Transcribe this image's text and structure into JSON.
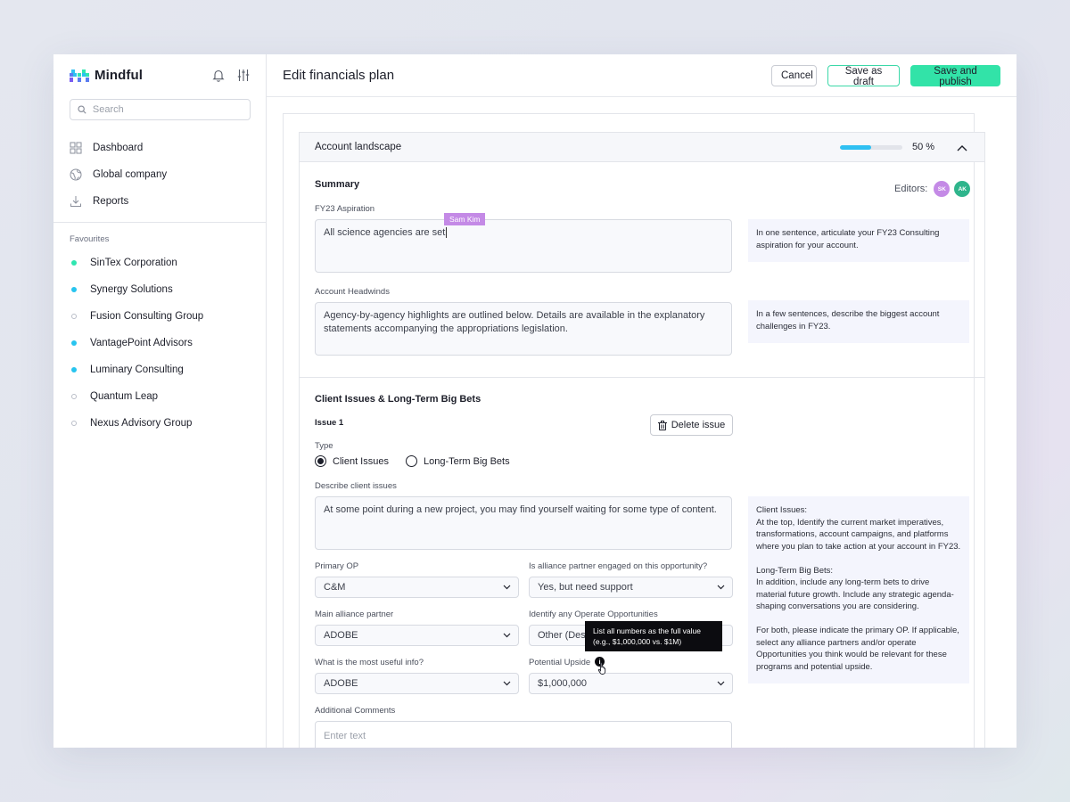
{
  "brand": {
    "name": "Mindful"
  },
  "sidebar": {
    "search_placeholder": "Search",
    "nav": [
      {
        "label": "Dashboard",
        "icon": "grid-icon"
      },
      {
        "label": "Global company",
        "icon": "globe-icon"
      },
      {
        "label": "Reports",
        "icon": "download-icon"
      }
    ],
    "favourites_title": "Favourites",
    "favourites": [
      {
        "label": "SinTex Corporation",
        "status": "filled",
        "color": "#2ee6b0"
      },
      {
        "label": "Synergy Solutions",
        "status": "filled",
        "color": "#27c4ef"
      },
      {
        "label": "Fusion Consulting Group",
        "status": "hollow",
        "color": ""
      },
      {
        "label": "VantagePoint Advisors",
        "status": "filled",
        "color": "#27c4ef"
      },
      {
        "label": "Luminary Consulting",
        "status": "filled",
        "color": "#27c4ef"
      },
      {
        "label": "Quantum Leap",
        "status": "hollow",
        "color": ""
      },
      {
        "label": "Nexus Advisory Group",
        "status": "hollow",
        "color": ""
      }
    ]
  },
  "header": {
    "title": "Edit financials plan",
    "cancel_label": "Cancel",
    "draft_label": "Save as draft",
    "publish_label": "Save and publish"
  },
  "panel": {
    "title": "Account landscape",
    "progress_percent": 50,
    "progress_text": "50 %"
  },
  "summary": {
    "title": "Summary",
    "editors_label": "Editors:",
    "editors": [
      {
        "initials": "SK",
        "color": "#c48ae6"
      },
      {
        "initials": "AK",
        "color": "#2fb58c"
      }
    ],
    "aspiration_label": "FY23 Aspiration",
    "aspiration_value": "All science agencies are set",
    "typing_user": "Sam Kim",
    "aspiration_hint": "In one sentence, articulate your FY23 Consulting aspiration for your account.",
    "headwinds_label": "Account Headwinds",
    "headwinds_value": "Agency-by-agency highlights are outlined below. Details are available in the explanatory statements accompanying the appropriations legislation.",
    "headwinds_hint": "In a few sentences, describe the biggest account challenges in FY23."
  },
  "issues": {
    "title": "Client Issues & Long-Term Big Bets",
    "issue_title": "Issue 1",
    "delete_label": "Delete issue",
    "type_label": "Type",
    "type_options": [
      "Client Issues",
      "Long-Term Big Bets"
    ],
    "type_selected": "Client Issues",
    "describe_label": "Describe client issues",
    "describe_value": "At some point during a new project, you may find yourself waiting for some type of content.",
    "primary_op_label": "Primary OP",
    "primary_op_value": "C&M",
    "alliance_engaged_label": "Is alliance partner engaged on this opportunity?",
    "alliance_engaged_value": "Yes, but need support",
    "main_alliance_label": "Main alliance partner",
    "main_alliance_value": "ADOBE",
    "operate_label": "Identify any Operate Opportunities",
    "operate_value": "Other (Desc",
    "useful_info_label": "What is the most useful info?",
    "useful_info_value": "ADOBE",
    "upside_label": "Potential Upside",
    "upside_value": "$1,000,000",
    "tooltip_line1": "List all numbers as the full value",
    "tooltip_line2": "(e.g., $1,000,000 vs. $1M)",
    "comments_label": "Additional Comments",
    "comments_placeholder": "Enter text",
    "hint": {
      "client_title": "Client Issues:",
      "client_body": "At the top, Identify the current market imperatives, transformations, account campaigns, and platforms where you plan to take action at your account in FY23.",
      "bets_title": "Long-Term Big Bets:",
      "bets_body": "In addition, include any long-term bets to drive material future growth. Include any strategic agenda-shaping conversations you are considering.",
      "both_body": "For both, please indicate the primary OP. If applicable, select any alliance partners and/or operate Opportunities you think would be relevant for these programs and potential upside."
    }
  },
  "colors": {
    "accent": "#32e3a8",
    "progress": "#2fc0f2",
    "tooltip_bg": "#0c0c10",
    "hint_bg": "#f4f5fd"
  }
}
